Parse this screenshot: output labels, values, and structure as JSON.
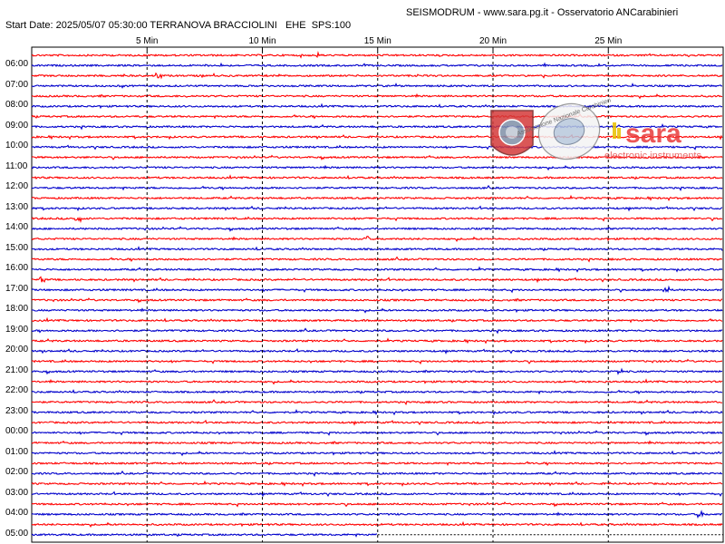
{
  "header": {
    "title": "SEISMODRUM - www.sara.pg.it - Osservatorio ANCarabinieri",
    "subtitle": "Start Date: 2025/05/07 05:30:00 TERRANOVA BRACCIOLINI   EHE  SPS:100"
  },
  "watermark": {
    "brand": "sara",
    "tagline": "electronic instruments",
    "seal_text": "Associazione Nazionale Carabinieri"
  },
  "chart_data": {
    "type": "line",
    "title": "SEISMODRUM - www.sara.pg.it - Osservatorio ANCarabinieri",
    "xlabel": "",
    "ylabel": "",
    "x_ticks": [
      "5 Min",
      "10 Min",
      "15 Min",
      "20 Min",
      "25 Min"
    ],
    "x_tick_minutes": [
      5,
      10,
      15,
      20,
      25
    ],
    "x_range_minutes": [
      0,
      30
    ],
    "row_duration_minutes": 15,
    "y_ticks": [
      "06:00",
      "07:00",
      "08:00",
      "09:00",
      "10:00",
      "11:00",
      "12:00",
      "13:00",
      "14:00",
      "15:00",
      "16:00",
      "17:00",
      "18:00",
      "19:00",
      "20:00",
      "21:00",
      "22:00",
      "23:00",
      "00:00",
      "01:00",
      "02:00",
      "03:00",
      "04:00",
      "05:00"
    ],
    "colors": {
      "odd_trace": "#ff0000",
      "even_trace": "#0000cc",
      "grid": "#000000"
    },
    "grid_vertical": "dashed",
    "trace_count": 48,
    "last_trace_end_minute": 15,
    "notable_events_minutes": [
      {
        "trace": 0,
        "minute": 12.5
      },
      {
        "trace": 2,
        "minute": 5.5
      },
      {
        "trace": 16,
        "minute": 2
      },
      {
        "trace": 18,
        "minute": 14.5
      },
      {
        "trace": 22,
        "minute": 0.5
      },
      {
        "trace": 23,
        "minute": 27.5
      },
      {
        "trace": 31,
        "minute": 25.5
      },
      {
        "trace": 45,
        "minute": 29
      }
    ]
  }
}
